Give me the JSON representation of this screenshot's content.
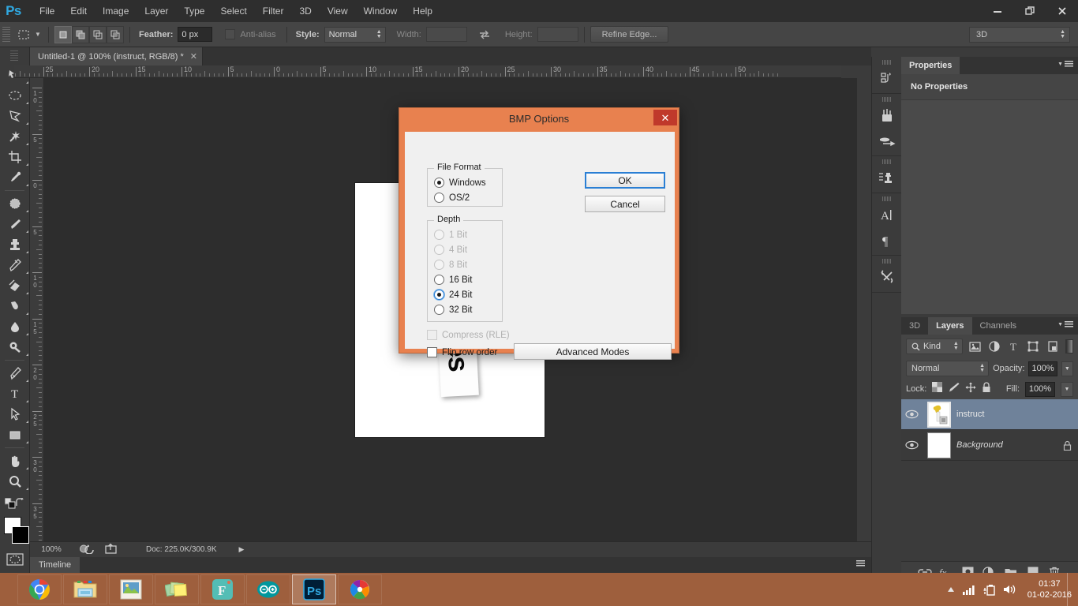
{
  "app": {
    "logo": "Ps",
    "menus": [
      "File",
      "Edit",
      "Image",
      "Layer",
      "Type",
      "Select",
      "Filter",
      "3D",
      "View",
      "Window",
      "Help"
    ],
    "window_controls": [
      "minimize",
      "restore",
      "close"
    ]
  },
  "options_bar": {
    "tool_icon": "rectangular-marquee-icon",
    "selection_modes": [
      "new-selection",
      "add-to-selection",
      "subtract-from-selection",
      "intersect-selection"
    ],
    "feather_label": "Feather:",
    "feather_value": "0 px",
    "antialias_label": "Anti-alias",
    "antialias_checked": false,
    "style_label": "Style:",
    "style_value": "Normal",
    "width_label": "Width:",
    "width_value": "",
    "height_label": "Height:",
    "height_value": "",
    "refine_edge_label": "Refine Edge...",
    "workspace_value": "3D"
  },
  "toolbar": {
    "tools": [
      "move-tool",
      "rectangular-marquee-tool",
      "lasso-tool",
      "magic-wand-tool",
      "crop-tool",
      "eyedropper-tool",
      "spot-healing-brush-tool",
      "brush-tool",
      "clone-stamp-tool",
      "history-brush-tool",
      "eraser-tool",
      "gradient-tool",
      "blur-tool",
      "dodge-tool",
      "pen-tool",
      "type-tool",
      "path-selection-tool",
      "rectangle-tool",
      "hand-tool",
      "zoom-tool"
    ],
    "foreground_color": "#ffffff",
    "background_color": "#000000",
    "quick_mask": "quick-mask-icon"
  },
  "document": {
    "tab_title": "Untitled-1 @ 100% (instruct, RGB/8) *",
    "canvas_text": "ables",
    "ruler_h_labels": [
      "30",
      "25",
      "20",
      "15",
      "10",
      "5",
      "0",
      "5",
      "10",
      "15",
      "20",
      "25",
      "30",
      "35",
      "40",
      "45",
      "50"
    ],
    "ruler_v_labels": [
      "1 0",
      "5",
      "0",
      "5",
      "1 0",
      "1 5",
      "2 0",
      "2 5",
      "3 0",
      "3 5"
    ]
  },
  "status_bar": {
    "zoom": "100%",
    "doc_info": "Doc: 225.0K/300.9K",
    "timeline_tab": "Timeline"
  },
  "icon_rail": {
    "icons": [
      "history-icon",
      "brush-icon",
      "brush-presets-icon",
      "clone-source-icon",
      "character-icon",
      "paragraph-icon",
      "tool-presets-icon"
    ]
  },
  "properties_panel": {
    "tab": "Properties",
    "empty_message": "No Properties"
  },
  "layers_panel": {
    "tabs": [
      {
        "label": "3D",
        "active": false
      },
      {
        "label": "Layers",
        "active": true
      },
      {
        "label": "Channels",
        "active": false
      }
    ],
    "filter_kind_label": "Kind",
    "filter_icons": [
      "filter-pixel-icon",
      "filter-adjustment-icon",
      "filter-type-icon",
      "filter-shape-icon",
      "filter-smart-object-icon"
    ],
    "blend_mode": "Normal",
    "opacity_label": "Opacity:",
    "opacity_value": "100%",
    "fill_label": "Fill:",
    "fill_value": "100%",
    "lock_label": "Lock:",
    "lock_icons": [
      "lock-transparency-icon",
      "lock-image-icon",
      "lock-position-icon",
      "lock-all-icon"
    ],
    "layers": [
      {
        "name": "instruct",
        "selected": true,
        "visible": true,
        "locked": false,
        "italic": false
      },
      {
        "name": "Background",
        "selected": false,
        "visible": true,
        "locked": true,
        "italic": true
      }
    ],
    "bottom_icons": [
      "link-layers-icon",
      "layer-style-icon",
      "layer-mask-icon",
      "adjustment-layer-icon",
      "new-group-icon",
      "new-layer-icon",
      "delete-layer-icon"
    ]
  },
  "dialog": {
    "title": "BMP Options",
    "close_label": "✕",
    "file_format": {
      "legend": "File Format",
      "options": [
        {
          "label": "Windows",
          "checked": true,
          "disabled": false
        },
        {
          "label": "OS/2",
          "checked": false,
          "disabled": false
        }
      ]
    },
    "depth": {
      "legend": "Depth",
      "options": [
        {
          "label": "1 Bit",
          "checked": false,
          "disabled": true
        },
        {
          "label": "4 Bit",
          "checked": false,
          "disabled": true
        },
        {
          "label": "8 Bit",
          "checked": false,
          "disabled": true
        },
        {
          "label": "16 Bit",
          "checked": false,
          "disabled": false
        },
        {
          "label": "24 Bit",
          "checked": true,
          "disabled": false
        },
        {
          "label": "32 Bit",
          "checked": false,
          "disabled": false
        }
      ]
    },
    "compress_label": "Compress (RLE)",
    "compress_checked": false,
    "compress_disabled": true,
    "flip_label": "Flip row order",
    "flip_checked": false,
    "ok_label": "OK",
    "cancel_label": "Cancel",
    "advanced_label": "Advanced Modes",
    "titlebar_color": "#e8814f"
  },
  "taskbar": {
    "apps": [
      {
        "name": "chrome",
        "active": false
      },
      {
        "name": "file-explorer",
        "active": false
      },
      {
        "name": "photos",
        "active": false
      },
      {
        "name": "sticky-notes",
        "active": false
      },
      {
        "name": "fritzing",
        "active": false
      },
      {
        "name": "arduino",
        "active": false
      },
      {
        "name": "photoshop",
        "active": true
      },
      {
        "name": "paint-net",
        "active": false
      }
    ],
    "tray_icons": [
      "show-hidden-icon",
      "network-icon",
      "battery-icon",
      "volume-icon"
    ],
    "time": "01:37",
    "date": "01-02-2016"
  }
}
